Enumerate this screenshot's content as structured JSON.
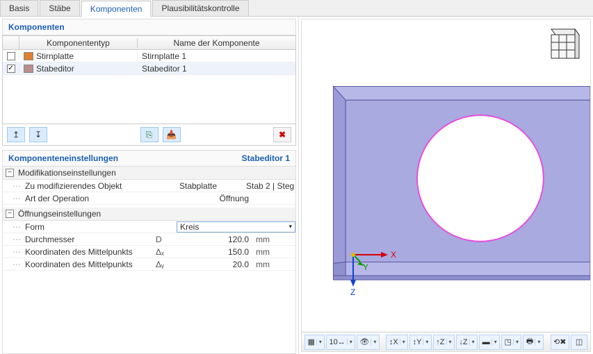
{
  "tabs": [
    "Basis",
    "Stäbe",
    "Komponenten",
    "Plausibilitätskontrolle"
  ],
  "active_tab": "Komponenten",
  "components": {
    "title": "Komponenten",
    "headers": {
      "type": "Komponententyp",
      "name": "Name der Komponente"
    },
    "rows": [
      {
        "checked": false,
        "color": "#e08030",
        "type": "Stirnplatte",
        "name": "Stirnplatte 1",
        "selected": false
      },
      {
        "checked": true,
        "color": "#bb8d8d",
        "type": "Stabeditor",
        "name": "Stabeditor 1",
        "selected": true
      }
    ],
    "toolbar": {
      "move_up": "↥",
      "move_down": "↧",
      "copy": "⎘",
      "import": "📥",
      "delete": "✖"
    }
  },
  "settings": {
    "title": "Komponenteneinstellungen",
    "context": "Stabeditor 1",
    "groups": [
      {
        "label": "Modifikationseinstellungen",
        "rows": [
          {
            "label": "Zu modifizierendes Objekt",
            "sym": "",
            "value": "Stabplatte",
            "extra": "Stab 2 | Steg",
            "unit": ""
          },
          {
            "label": "Art der Operation",
            "sym": "",
            "value": "Öffnung",
            "extra": "",
            "unit": ""
          }
        ]
      },
      {
        "label": "Öffnungseinstellungen",
        "rows": [
          {
            "label": "Form",
            "sym": "",
            "value": "Kreis",
            "dropdown": true,
            "unit": ""
          },
          {
            "label": "Durchmesser",
            "sym": "D",
            "value": "120.0",
            "unit": "mm"
          },
          {
            "label": "Koordinaten des Mittelpunkts",
            "sym": "Δₓ",
            "value": "150.0",
            "unit": "mm"
          },
          {
            "label": "Koordinaten des Mittelpunkts",
            "sym": "Δᵧ",
            "value": "20.0",
            "unit": "mm"
          }
        ]
      }
    ]
  },
  "view_toolbar": {
    "items": [
      {
        "name": "display-mode",
        "label": "▦",
        "dd": true
      },
      {
        "name": "zoom-factor",
        "label": "10↔",
        "dd": true
      },
      {
        "name": "show-hide",
        "label": "👁",
        "dd": true
      },
      {
        "name": "sep"
      },
      {
        "name": "view-x",
        "label": "↕X",
        "dd": true
      },
      {
        "name": "view-y",
        "label": "↕Y",
        "dd": true
      },
      {
        "name": "view-z-up",
        "label": "↑Z",
        "dd": true
      },
      {
        "name": "view-z-down",
        "label": "↓Z",
        "dd": true
      },
      {
        "name": "iso-view",
        "label": "▬",
        "dd": true
      },
      {
        "name": "render-mode",
        "label": "◳",
        "dd": true
      },
      {
        "name": "print",
        "label": "🖶",
        "dd": true
      },
      {
        "name": "sep"
      },
      {
        "name": "reset-view",
        "label": "⟲✖",
        "dd": false
      },
      {
        "name": "new-window",
        "label": "◫",
        "dd": false
      }
    ]
  },
  "axes": {
    "x": "X",
    "y": "Y",
    "z": "Z"
  }
}
